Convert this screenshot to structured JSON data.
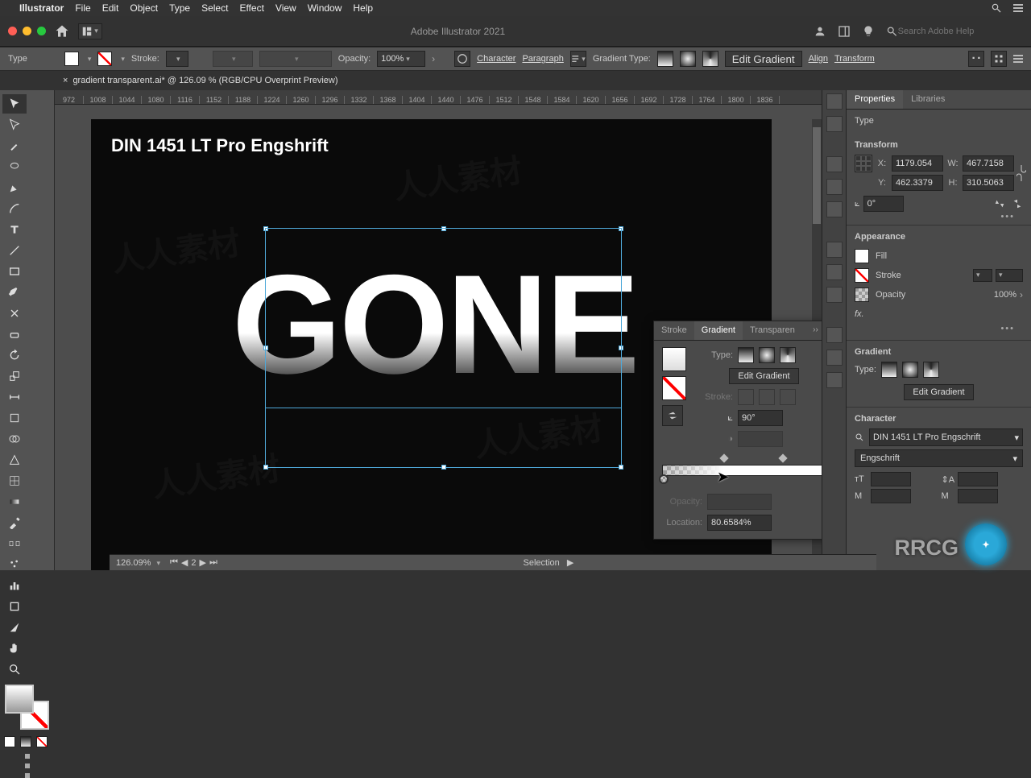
{
  "menubar": {
    "app": "Illustrator",
    "items": [
      "File",
      "Edit",
      "Object",
      "Type",
      "Select",
      "Effect",
      "View",
      "Window",
      "Help"
    ]
  },
  "appbar": {
    "title": "Adobe Illustrator 2021",
    "search_placeholder": "Search Adobe Help"
  },
  "control": {
    "context_label": "Type",
    "stroke_label": "Stroke:",
    "opacity_label": "Opacity:",
    "opacity_value": "100%",
    "char_link": "Character",
    "para_link": "Paragraph",
    "grad_type_label": "Gradient Type:",
    "edit_gradient": "Edit Gradient",
    "align": "Align",
    "transform": "Transform"
  },
  "doc_tab": {
    "name": "gradient transparent.ai* @ 126.09 % (RGB/CPU Overprint Preview)"
  },
  "ruler_ticks": [
    "972",
    "1008",
    "1044",
    "1080",
    "1116",
    "1152",
    "1188",
    "1224",
    "1260",
    "1296",
    "1332",
    "1368",
    "1404",
    "1440",
    "1476",
    "1512",
    "1548",
    "1584",
    "1620",
    "1656",
    "1692",
    "1728",
    "1764",
    "1800",
    "1836"
  ],
  "artboard": {
    "font_label": "DIN 1451 LT Pro Engshrift",
    "big_text": "GONE"
  },
  "float_panel": {
    "tabs": {
      "stroke": "Stroke",
      "gradient": "Gradient",
      "transparency": "Transparen"
    },
    "type_label": "Type:",
    "edit_gradient": "Edit Gradient",
    "stroke_label": "Stroke:",
    "angle_value": "90°",
    "opacity_label": "Opacity:",
    "location_label": "Location:",
    "location_value": "80.6584%",
    "diamond1_pct": 35,
    "diamond2_pct": 68
  },
  "right_panels": {
    "tabs": {
      "properties": "Properties",
      "libraries": "Libraries"
    },
    "context": "Type",
    "transform": {
      "title": "Transform",
      "x": "1179.054",
      "y": "462.3379",
      "w": "467.7158",
      "h": "310.5063",
      "angle": "0°"
    },
    "appearance": {
      "title": "Appearance",
      "fill": "Fill",
      "stroke": "Stroke",
      "opacity": "Opacity",
      "opacity_value": "100%",
      "fx": "fx."
    },
    "gradient": {
      "title": "Gradient",
      "type_label": "Type:",
      "edit": "Edit Gradient"
    },
    "character": {
      "title": "Character",
      "font": "DIN 1451 LT Pro Engschrift",
      "style": "Engschrift"
    }
  },
  "status": {
    "zoom": "126.09%",
    "page": "2",
    "mode": "Selection"
  },
  "badge_text": "RRCG"
}
